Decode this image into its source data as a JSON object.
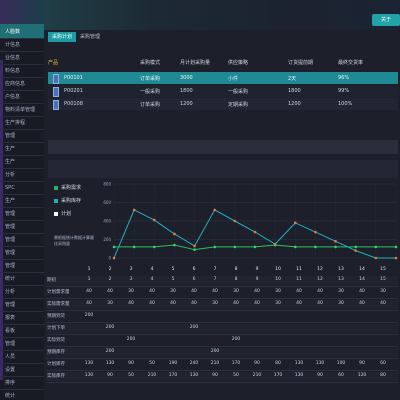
{
  "sidebar": {
    "items": [
      {
        "label": "人脸数",
        "active": true
      },
      {
        "label": "计信息"
      },
      {
        "label": "业信息"
      },
      {
        "label": "料信息"
      },
      {
        "label": "应商信息"
      },
      {
        "label": "户信息"
      },
      {
        "label": "物料清单管理"
      },
      {
        "label": "生产排程"
      },
      {
        "label": "管理"
      },
      {
        "label": "生产"
      },
      {
        "label": "生产"
      },
      {
        "label": "分析"
      },
      {
        "label": "SPC"
      },
      {
        "label": "生产"
      },
      {
        "label": "管理"
      },
      {
        "label": "管理"
      },
      {
        "label": "管理"
      },
      {
        "label": "管理"
      },
      {
        "label": "管理"
      },
      {
        "label": "统计"
      },
      {
        "label": "分析"
      },
      {
        "label": "管理"
      },
      {
        "label": "报表"
      },
      {
        "label": "看板"
      },
      {
        "label": "管理"
      },
      {
        "label": "人员"
      },
      {
        "label": "设置"
      },
      {
        "label": "排序"
      },
      {
        "label": "统计"
      }
    ]
  },
  "topbar": {
    "button_label": "关于"
  },
  "tabs": [
    {
      "label": "采购计划",
      "active": true
    },
    {
      "label": "采购管理",
      "active": false
    }
  ],
  "product_table": {
    "section_label": "产品",
    "headers": [
      "采购模式",
      "月计划采购量",
      "供应策略",
      "订货提前期",
      "最终交货率"
    ],
    "rows": [
      {
        "code": "P00101",
        "mode": "订单采购",
        "qty": "3000",
        "strategy": "小件",
        "lead": "2天",
        "rate": "96%",
        "selected": true
      },
      {
        "code": "P00201",
        "mode": "一般采购",
        "qty": "1800",
        "strategy": "一般采购",
        "lead": "1800",
        "rate": "99%",
        "selected": false
      },
      {
        "code": "P00108",
        "mode": "订单采购",
        "qty": "1200",
        "strategy": "定期采购",
        "lead": "1200",
        "rate": "100%",
        "selected": false
      }
    ]
  },
  "legend": [
    {
      "label": "采购需求",
      "color": "#27b45a"
    },
    {
      "label": "采购库存",
      "color": "#1fb0c0"
    },
    {
      "label": "计划",
      "color": "#ffffff"
    }
  ],
  "chart_note": "需根据统计数据计算最佳采购量",
  "chart_data": {
    "type": "line",
    "x": [
      1,
      2,
      3,
      4,
      5,
      6,
      7,
      8,
      9,
      10,
      11,
      12,
      13,
      14,
      15
    ],
    "ylim": [
      0,
      800
    ],
    "yticks": [
      0,
      200,
      400,
      600,
      800
    ],
    "series": [
      {
        "name": "采购需求",
        "color": "#2cc15a",
        "values": [
          120,
          120,
          120,
          140,
          90,
          120,
          120,
          120,
          140,
          120,
          120,
          120,
          120,
          120,
          120
        ]
      },
      {
        "name": "采购库存",
        "color": "#1fb0c0",
        "values": [
          0,
          520,
          410,
          260,
          130,
          520,
          400,
          280,
          150,
          380,
          280,
          180,
          80,
          0,
          0
        ]
      }
    ]
  },
  "grid": {
    "columns": [
      "1",
      "2",
      "3",
      "4",
      "5",
      "6",
      "7",
      "8",
      "9",
      "10",
      "11",
      "12",
      "13",
      "14",
      "15"
    ],
    "rows": [
      {
        "label": "期初",
        "values": [
          "1",
          "2",
          "3",
          "4",
          "5",
          "6",
          "7",
          "8",
          "9",
          "10",
          "11",
          "12",
          "13",
          "14",
          "15"
        ]
      },
      {
        "label": "计划需求量",
        "values": [
          "40",
          "40",
          "30",
          "40",
          "30",
          "40",
          "40",
          "30",
          "40",
          "30",
          "40",
          "40",
          "30",
          "40",
          "30"
        ]
      },
      {
        "label": "实际需求量",
        "values": [
          "40",
          "30",
          "40",
          "40",
          "40",
          "40",
          "30",
          "40",
          "40",
          "30",
          "40",
          "40",
          "30",
          "40",
          "40"
        ]
      },
      {
        "label": "预期到货",
        "values": [
          "200",
          "",
          "",
          "",
          "",
          "",
          "",
          "",
          "",
          "",
          "",
          "",
          "",
          "",
          ""
        ]
      },
      {
        "label": "计划下单",
        "values": [
          "",
          "200",
          "",
          "",
          "",
          "200",
          "",
          "",
          "",
          "",
          "",
          "",
          "",
          "",
          ""
        ]
      },
      {
        "label": "实际到货",
        "values": [
          "",
          "",
          "200",
          "",
          "",
          "",
          "",
          "200",
          "",
          "",
          "",
          "",
          "",
          "",
          ""
        ]
      },
      {
        "label": "预期库存",
        "values": [
          "",
          "200",
          "",
          "",
          "",
          "",
          "200",
          "",
          "",
          "",
          "",
          "",
          "",
          "",
          ""
        ]
      },
      {
        "label": "计划库存",
        "values": [
          "130",
          "130",
          "90",
          "50",
          "190",
          "240",
          "210",
          "170",
          "90",
          "80",
          "130",
          "130",
          "100",
          "90",
          "60"
        ]
      },
      {
        "label": "实际库存",
        "values": [
          "130",
          "90",
          "50",
          "210",
          "170",
          "130",
          "90",
          "50",
          "210",
          "170",
          "130",
          "90",
          "60",
          "120",
          "80"
        ]
      }
    ]
  }
}
